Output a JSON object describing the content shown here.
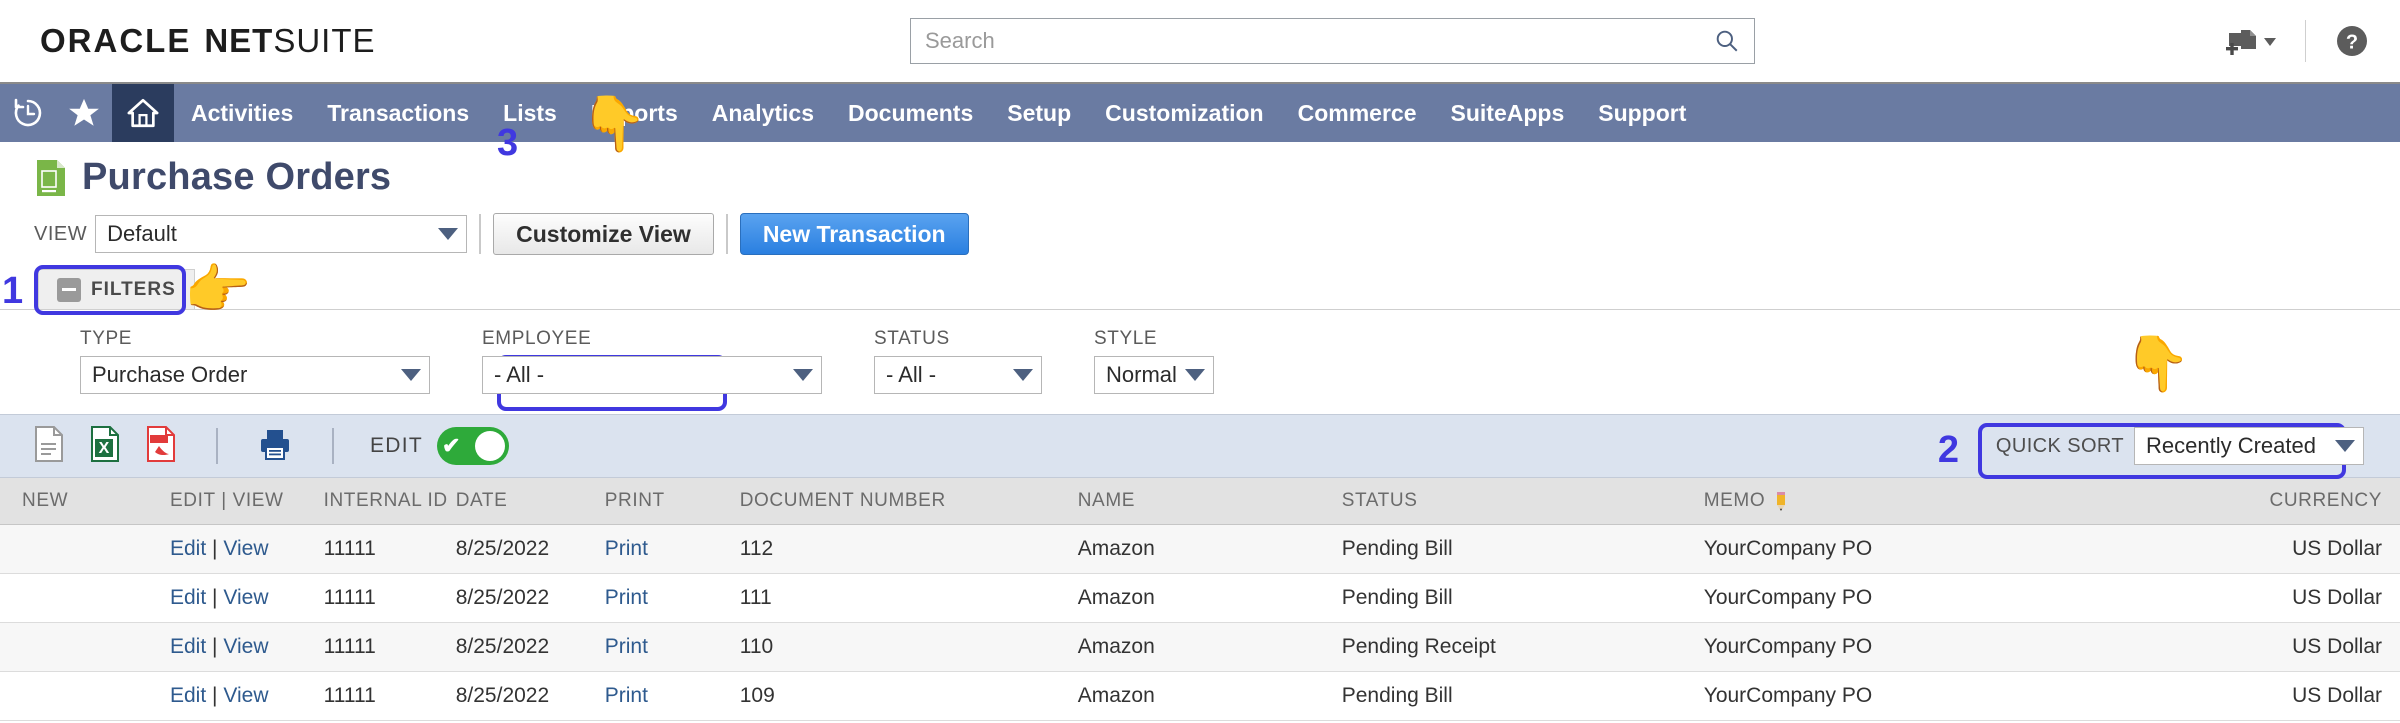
{
  "brand": {
    "oracle": "ORACLE",
    "net": "NET",
    "suite": "SUITE"
  },
  "search": {
    "placeholder": "Search",
    "value": "",
    "icon": "search-icon"
  },
  "top_icons": [
    {
      "name": "add-shortcut-icon",
      "glyph": "❐"
    },
    {
      "name": "help-icon",
      "glyph": "?"
    }
  ],
  "nav": {
    "icons": [
      {
        "name": "recent-history-icon"
      },
      {
        "name": "favorites-star-icon"
      },
      {
        "name": "home-icon",
        "active": true
      }
    ],
    "items": [
      {
        "label": "Activities"
      },
      {
        "label": "Transactions"
      },
      {
        "label": "Lists"
      },
      {
        "label": "Reports"
      },
      {
        "label": "Analytics"
      },
      {
        "label": "Documents"
      },
      {
        "label": "Setup"
      },
      {
        "label": "Customization"
      },
      {
        "label": "Commerce"
      },
      {
        "label": "SuiteApps"
      },
      {
        "label": "Support"
      }
    ]
  },
  "page": {
    "title": "Purchase Orders",
    "icon": "purchase-order-document-icon"
  },
  "view_bar": {
    "view_label": "VIEW",
    "view_value": "Default",
    "customize_view_label": "Customize View",
    "new_transaction_label": "New Transaction"
  },
  "filters": {
    "tab_label": "FILTERS",
    "collapse_icon": "minus-icon",
    "fields": [
      {
        "label": "TYPE",
        "value": "Purchase Order"
      },
      {
        "label": "EMPLOYEE",
        "value": "- All -"
      },
      {
        "label": "STATUS",
        "value": "- All -"
      },
      {
        "label": "STYLE",
        "value": "Normal"
      }
    ]
  },
  "toolbar": {
    "export_icons": [
      {
        "name": "export-csv-icon"
      },
      {
        "name": "export-excel-icon"
      },
      {
        "name": "export-pdf-icon"
      },
      {
        "name": "print-icon"
      }
    ],
    "edit_label": "EDIT",
    "edit_toggle_on": true,
    "quick_sort_label": "QUICK SORT",
    "quick_sort_value": "Recently Created"
  },
  "table": {
    "columns": [
      "NEW",
      "EDIT | VIEW",
      "INTERNAL ID",
      "DATE",
      "PRINT",
      "DOCUMENT NUMBER",
      "NAME",
      "STATUS",
      "MEMO",
      "CURRENCY"
    ],
    "memo_icon": "pencil-edit-icon",
    "rows": [
      {
        "new": "",
        "edit": "Edit",
        "sep": "|",
        "view": "View",
        "internal_id": "11111",
        "date": "8/25/2022",
        "print": "Print",
        "document_number": "112",
        "name": "Amazon",
        "status": "Pending Bill",
        "memo": "YourCompany PO",
        "currency": "US Dollar"
      },
      {
        "new": "",
        "edit": "Edit",
        "sep": "|",
        "view": "View",
        "internal_id": "11111",
        "date": "8/25/2022",
        "print": "Print",
        "document_number": "111",
        "name": "Amazon",
        "status": "Pending Bill",
        "memo": "YourCompany PO",
        "currency": "US Dollar"
      },
      {
        "new": "",
        "edit": "Edit",
        "sep": "|",
        "view": "View",
        "internal_id": "11111",
        "date": "8/25/2022",
        "print": "Print",
        "document_number": "110",
        "name": "Amazon",
        "status": "Pending Receipt",
        "memo": "YourCompany PO",
        "currency": "US Dollar"
      },
      {
        "new": "",
        "edit": "Edit",
        "sep": "|",
        "view": "View",
        "internal_id": "11111",
        "date": "8/25/2022",
        "print": "Print",
        "document_number": "109",
        "name": "Amazon",
        "status": "Pending Bill",
        "memo": "YourCompany PO",
        "currency": "US Dollar"
      }
    ]
  },
  "annotations": {
    "one": "1",
    "two": "2",
    "three": "3",
    "hand_down": "👇",
    "hand_right": "👉",
    "highlight_color": "#4038e0"
  }
}
